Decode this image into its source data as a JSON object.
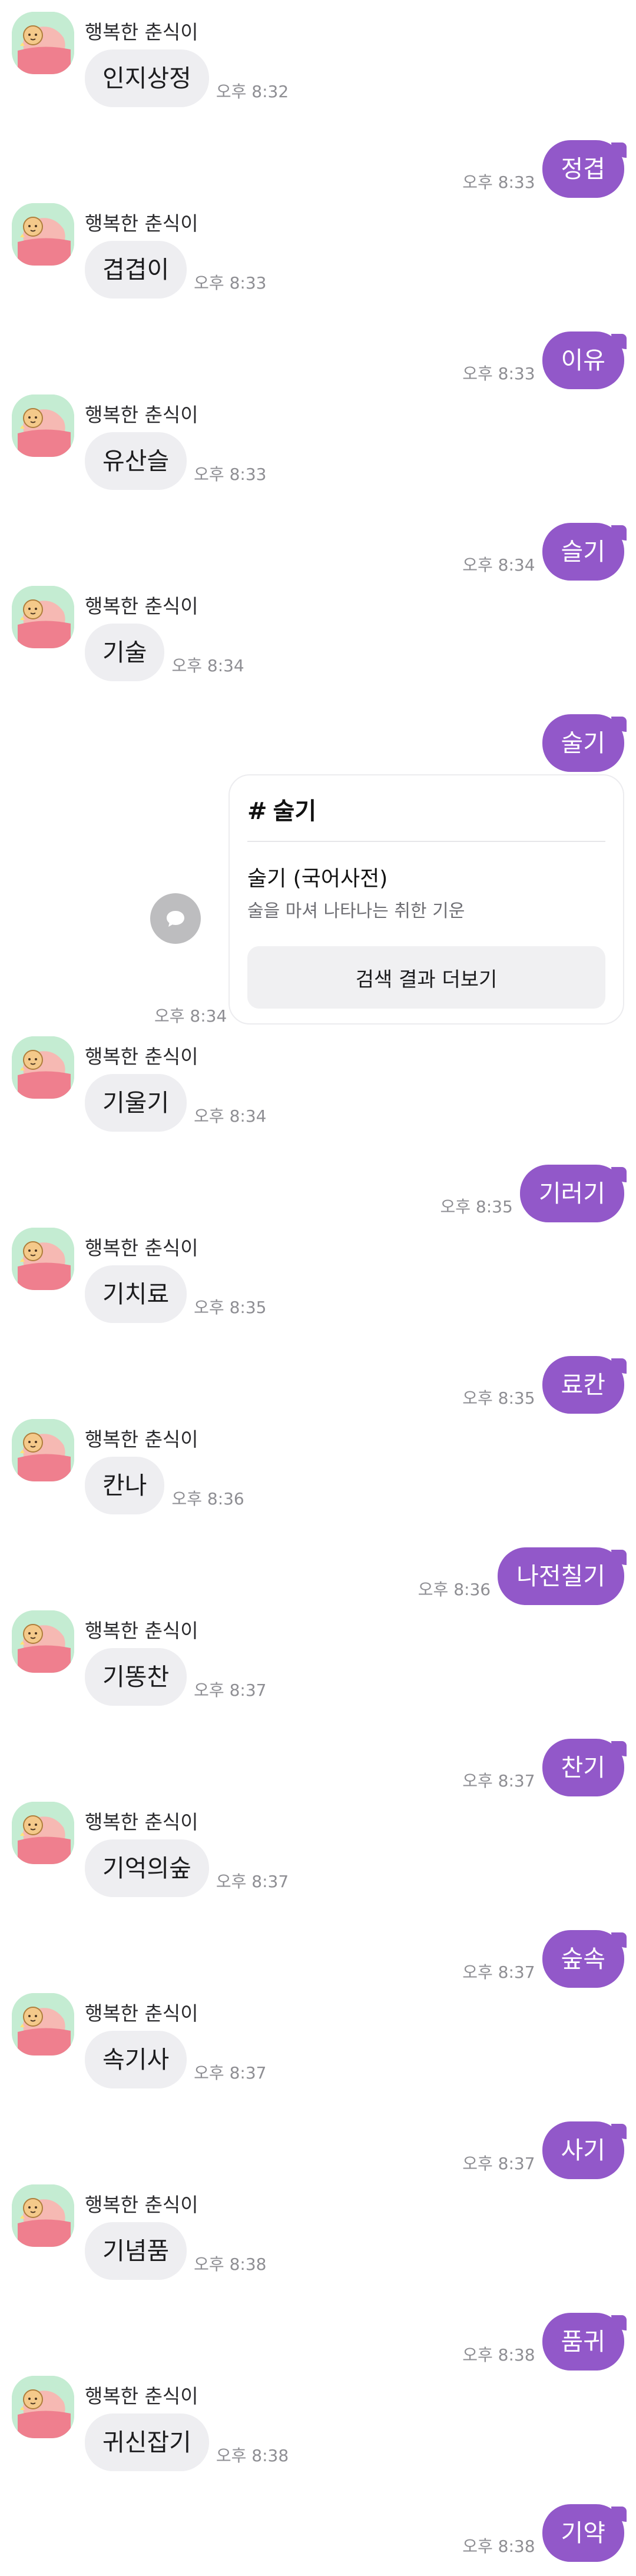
{
  "sender_name": "행복한 춘식이",
  "messages": [
    {
      "dir": "in",
      "text": "인지상정",
      "time": "오후 8:32"
    },
    {
      "dir": "out",
      "text": "정겹",
      "time": "오후 8:33"
    },
    {
      "dir": "in",
      "text": "겹겹이",
      "time": "오후 8:33"
    },
    {
      "dir": "out",
      "text": "이유",
      "time": "오후 8:33"
    },
    {
      "dir": "in",
      "text": "유산슬",
      "time": "오후 8:33"
    },
    {
      "dir": "out",
      "text": "슬기",
      "time": "오후 8:34"
    },
    {
      "dir": "in",
      "text": "기술",
      "time": "오후 8:34"
    },
    {
      "dir": "out",
      "text": "술기",
      "time": ""
    },
    {
      "dir": "in",
      "text": "기울기",
      "time": "오후 8:34"
    },
    {
      "dir": "out",
      "text": "기러기",
      "time": "오후 8:35"
    },
    {
      "dir": "in",
      "text": "기치료",
      "time": "오후 8:35"
    },
    {
      "dir": "out",
      "text": "료칸",
      "time": "오후 8:35"
    },
    {
      "dir": "in",
      "text": "칸나",
      "time": "오후 8:36"
    },
    {
      "dir": "out",
      "text": "나전칠기",
      "time": "오후 8:36"
    },
    {
      "dir": "in",
      "text": "기똥찬",
      "time": "오후 8:37"
    },
    {
      "dir": "out",
      "text": "찬기",
      "time": "오후 8:37"
    },
    {
      "dir": "in",
      "text": "기억의숲",
      "time": "오후 8:37"
    },
    {
      "dir": "out",
      "text": "숲속",
      "time": "오후 8:37"
    },
    {
      "dir": "in",
      "text": "속기사",
      "time": "오후 8:37"
    },
    {
      "dir": "out",
      "text": "사기",
      "time": "오후 8:37"
    },
    {
      "dir": "in",
      "text": "기념품",
      "time": "오후 8:38"
    },
    {
      "dir": "out",
      "text": "품귀",
      "time": "오후 8:38"
    },
    {
      "dir": "in",
      "text": "귀신잡기",
      "time": "오후 8:38"
    },
    {
      "dir": "out",
      "text": "기약",
      "time": "오후 8:38"
    }
  ],
  "search_card": {
    "hash": "#",
    "keyword": "술기",
    "title": "술기 (국어사전)",
    "description": "술을 마셔 나타나는 취한 기운",
    "button": "검색 결과 더보기",
    "time": "오후 8:34"
  },
  "colors": {
    "outgoing_bubble": "#9258c9",
    "incoming_bubble": "#eeeef1",
    "avatar_background": "#c4ecd2"
  },
  "icons": {
    "avatar": "choonsik-character-icon",
    "share": "speech-bubble-icon"
  }
}
